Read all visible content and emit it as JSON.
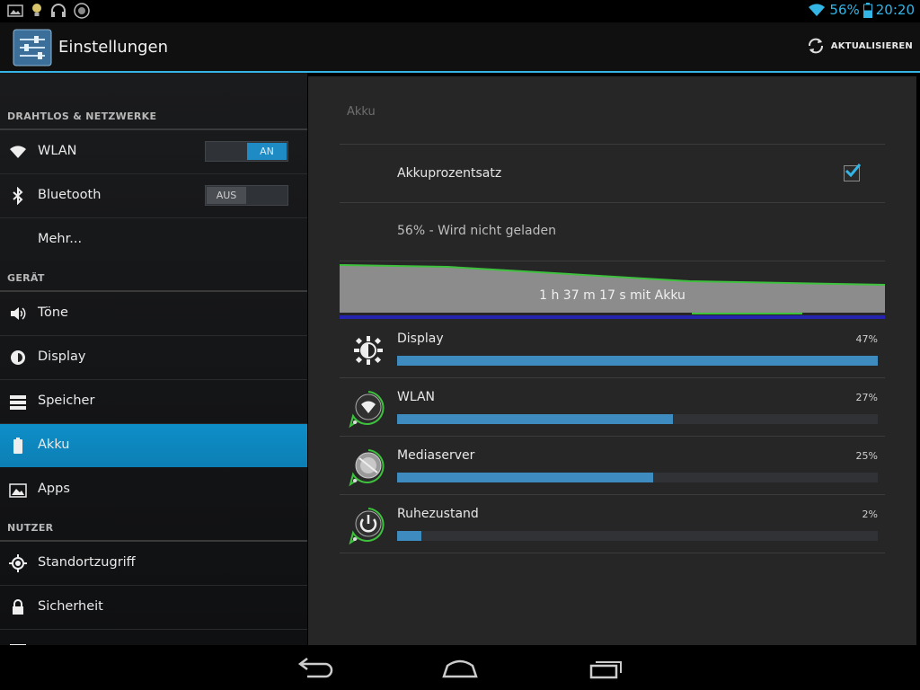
{
  "status": {
    "battery_percent": "56%",
    "time": "20:20",
    "icons": [
      "image-icon",
      "lightbulb-icon",
      "headphones-icon",
      "app-circle-icon",
      "wifi-signal-icon",
      "battery-icon"
    ],
    "accent": "#33b5e5"
  },
  "actionbar": {
    "title": "Einstellungen",
    "refresh_label": "AKTUALISIEREN"
  },
  "sidebar": {
    "sections": [
      {
        "header": "DRAHTLOS & NETZWERKE"
      },
      {
        "header": "GERÄT"
      },
      {
        "header": "NUTZER"
      }
    ],
    "items": {
      "wlan": {
        "label": "WLAN",
        "toggle": "AN"
      },
      "bluetooth": {
        "label": "Bluetooth",
        "toggle": "AUS"
      },
      "more": {
        "label": "Mehr..."
      },
      "sound": {
        "label": "Töne"
      },
      "display": {
        "label": "Display"
      },
      "storage": {
        "label": "Speicher"
      },
      "battery": {
        "label": "Akku"
      },
      "apps": {
        "label": "Apps"
      },
      "location": {
        "label": "Standortzugriff"
      },
      "security": {
        "label": "Sicherheit"
      }
    },
    "selected_color": "#0e8ec8"
  },
  "main": {
    "title": "Akku",
    "percent_setting": {
      "label": "Akkuprozentsatz",
      "checked": true
    },
    "status_text": "56% - Wird nicht geladen",
    "graph_label": "1 h 37 m 17 s mit Akku",
    "usage": [
      {
        "name": "Display",
        "percent": "47%",
        "fraction": 1.0,
        "icon": "brightness-icon"
      },
      {
        "name": "WLAN",
        "percent": "27%",
        "fraction": 0.574,
        "icon": "wifi-app-icon"
      },
      {
        "name": "Mediaserver",
        "percent": "25%",
        "fraction": 0.532,
        "icon": "mediaserver-icon"
      },
      {
        "name": "Ruhezustand",
        "percent": "2%",
        "fraction": 0.05,
        "icon": "power-icon"
      }
    ]
  },
  "navbar": {
    "buttons": [
      "back-icon",
      "home-icon",
      "recent-apps-icon"
    ]
  }
}
